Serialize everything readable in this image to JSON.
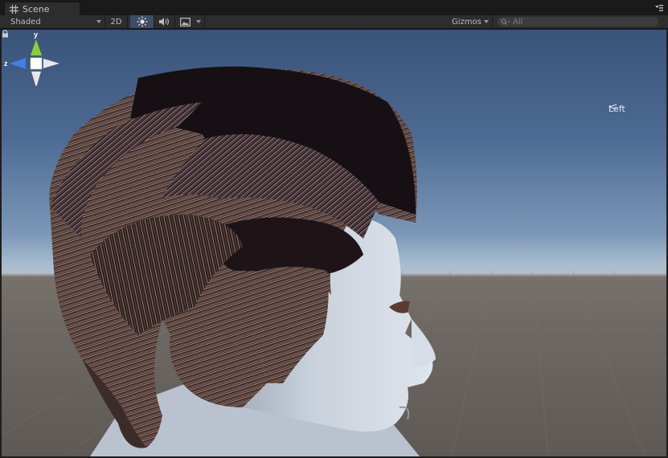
{
  "tab": {
    "title": "Scene"
  },
  "toolbar": {
    "shading_mode": "Shaded",
    "mode_2d_label": "2D",
    "gizmos_label": "Gizmos",
    "search_placeholder": "All"
  },
  "icons": {
    "tab": "scene-grid-icon",
    "menu": "panel-menu-icon",
    "lighting": "sun-icon",
    "audio": "speaker-icon",
    "effects": "image-icon",
    "search": "search-icon",
    "lock": "lock-icon"
  },
  "orientation_gizmo": {
    "y_axis_label": "y",
    "z_axis_label": "z",
    "view_label": "Left",
    "colors": {
      "y": "#8ccc3e",
      "z": "#3f7fe6",
      "neutral": "#e8e8e8"
    }
  },
  "colors": {
    "panel_bg": "#2d2d2d",
    "active_toggle": "#3d4d66",
    "sky_top": "#3a5379",
    "horizon": "#b2c0cd",
    "ground": "#6e6864"
  }
}
